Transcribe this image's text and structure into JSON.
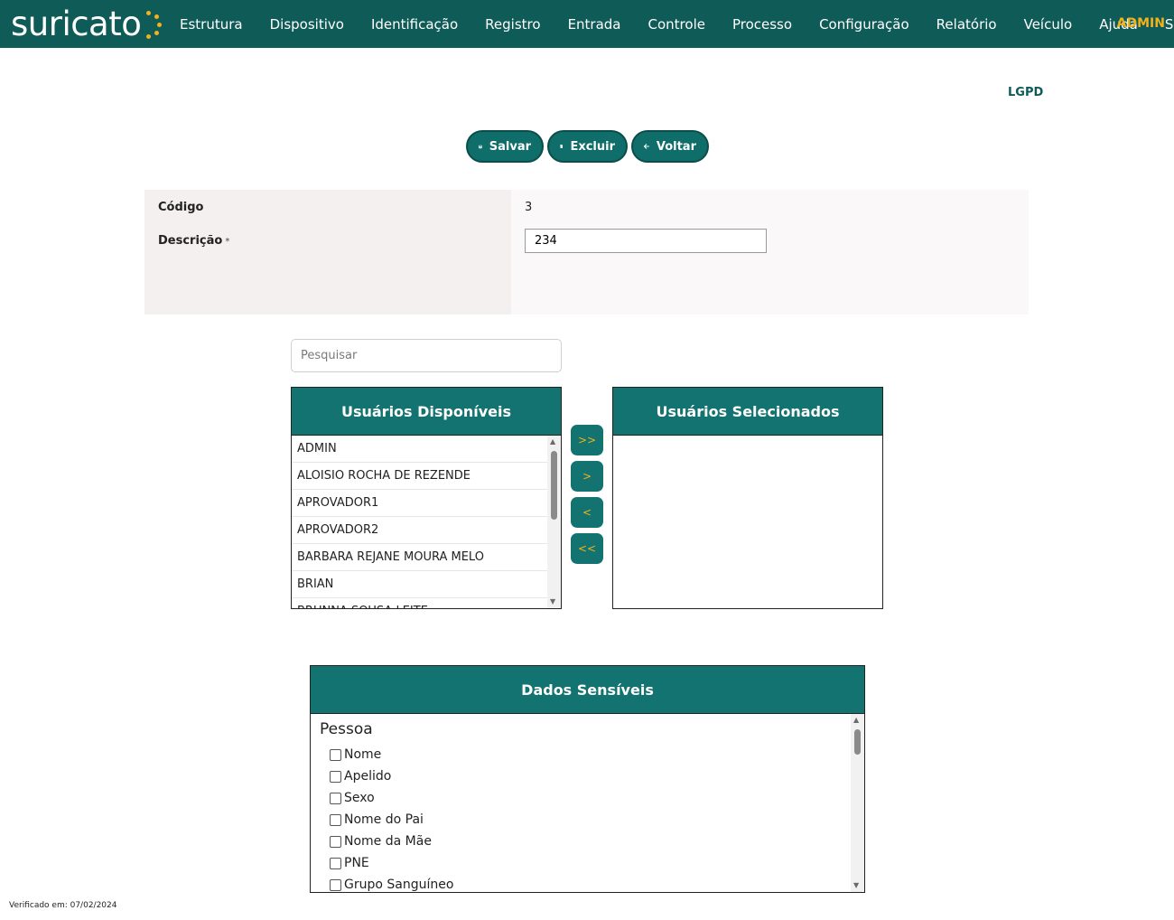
{
  "app": {
    "logo_text": "suricato",
    "nav": [
      "Estrutura",
      "Dispositivo",
      "Identificação",
      "Registro",
      "Entrada",
      "Controle",
      "Processo",
      "Configuração",
      "Relatório",
      "Veículo",
      "Ajuda",
      "Sair"
    ],
    "user": "ADMIN",
    "brand_color": "#0f5b57",
    "accent_color": "#f2b21b"
  },
  "page": {
    "title": "LGPD"
  },
  "toolbar": {
    "save_label": "Salvar",
    "delete_label": "Excluir",
    "back_label": "Voltar"
  },
  "form": {
    "code_label": "Código",
    "code_value": "3",
    "description_label": "Descrição",
    "required_mark": "*",
    "description_value": "234"
  },
  "search": {
    "placeholder": "Pesquisar"
  },
  "available_users": {
    "title": "Usuários Disponíveis",
    "items": [
      "ADMIN",
      "ALOISIO ROCHA DE REZENDE",
      "APROVADOR1",
      "APROVADOR2",
      "BARBARA REJANE MOURA MELO",
      "BRIAN",
      "BRUNNA SOUSA LEITE"
    ]
  },
  "selected_users": {
    "title": "Usuários Selecionados",
    "items": []
  },
  "transfer_buttons": [
    ">>",
    ">",
    "<",
    "<<"
  ],
  "sensitive_data": {
    "title": "Dados Sensíveis",
    "group": "Pessoa",
    "fields": [
      "Nome",
      "Apelido",
      "Sexo",
      "Nome do Pai",
      "Nome da Mãe",
      "PNE",
      "Grupo Sanguíneo"
    ]
  },
  "footer": {
    "verified": "Verificado em: 07/02/2024"
  }
}
